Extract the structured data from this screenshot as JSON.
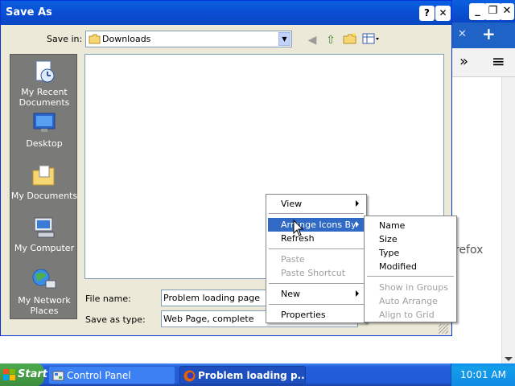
{
  "dialog": {
    "title": "Save As",
    "help_btn": "?",
    "close_btn": "✕",
    "save_in_label": "Save in:",
    "save_in_value": "Downloads",
    "places": [
      {
        "label": "My Recent Documents",
        "icon": "recent-documents-icon"
      },
      {
        "label": "Desktop",
        "icon": "desktop-icon"
      },
      {
        "label": "My Documents",
        "icon": "my-documents-icon"
      },
      {
        "label": "My Computer",
        "icon": "my-computer-icon"
      },
      {
        "label": "My Network Places",
        "icon": "network-places-icon"
      }
    ],
    "file_name_label": "File name:",
    "file_name_value": "Problem loading page",
    "save_type_label": "Save as type:",
    "save_type_value": "Web Page, complete"
  },
  "context_menu": {
    "items": [
      {
        "label": "View",
        "submenu": true
      },
      {
        "label": "Arrange Icons By",
        "submenu": true,
        "selected": true
      },
      {
        "label": "Refresh"
      },
      {
        "label": "Paste",
        "disabled": true
      },
      {
        "label": "Paste Shortcut",
        "disabled": true
      },
      {
        "label": "New",
        "submenu": true
      },
      {
        "label": "Properties"
      }
    ]
  },
  "arrange_submenu": {
    "items": [
      {
        "label": "Name"
      },
      {
        "label": "Size"
      },
      {
        "label": "Type"
      },
      {
        "label": "Modified"
      },
      {
        "label": "Show in Groups",
        "disabled": true
      },
      {
        "label": "Auto Arrange",
        "disabled": true
      },
      {
        "label": "Align to Grid",
        "disabled": true
      }
    ]
  },
  "background_window": {
    "partial_text": "refox",
    "tab_close": "✕",
    "new_tab": "+",
    "overflow": "»",
    "menu": "≡",
    "min": "_",
    "restore": "❐",
    "close": "✕"
  },
  "taskbar": {
    "start_label": "Start",
    "tasks": [
      {
        "label": "Control Panel",
        "active": false
      },
      {
        "label": "Problem loading p...",
        "active": true
      }
    ],
    "clock": "10:01 AM"
  },
  "colors": {
    "xp_blue": "#0a5fe0",
    "menu_highlight": "#316ac5",
    "dialog_face": "#ece9d8",
    "start_green": "#3c8e3c"
  }
}
